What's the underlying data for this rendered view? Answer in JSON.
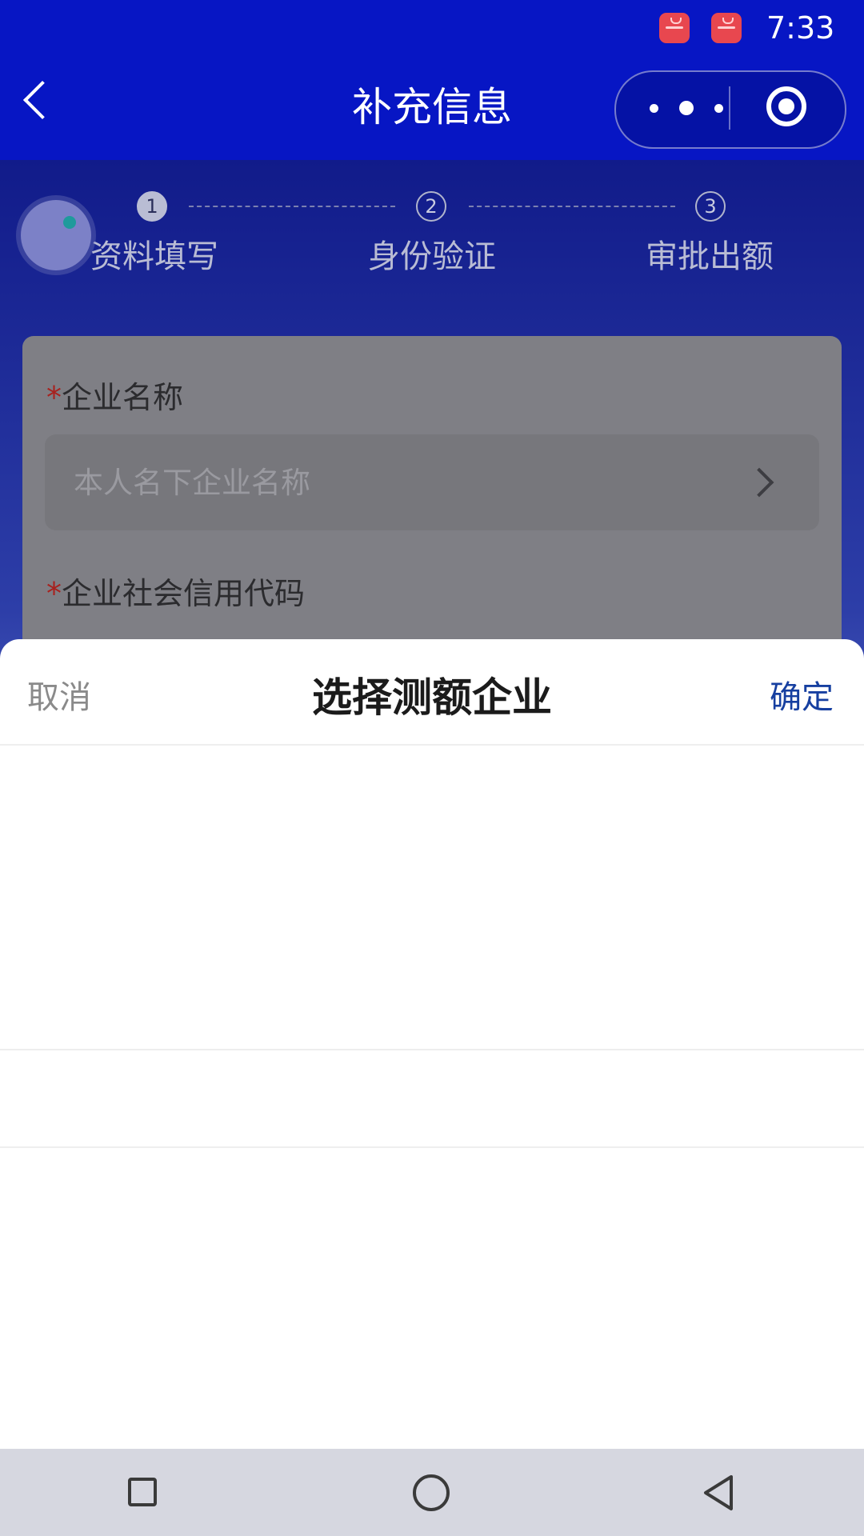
{
  "status_bar": {
    "time": "7:33",
    "icons": [
      "app-store-icon",
      "app-store-icon"
    ]
  },
  "nav_bar": {
    "title": "补充信息",
    "back_icon": "chevron-left-icon",
    "more_icon": "more-dots-icon",
    "close_icon": "target-circle-icon"
  },
  "steps": [
    {
      "number": "1",
      "label": "资料填写",
      "state": "active"
    },
    {
      "number": "2",
      "label": "身份验证",
      "state": "todo"
    },
    {
      "number": "3",
      "label": "审批出额",
      "state": "todo"
    }
  ],
  "form": {
    "required_mark": "*",
    "company_name": {
      "label": "企业名称",
      "placeholder": "本人名下企业名称"
    },
    "credit_code": {
      "label": "企业社会信用代码"
    }
  },
  "picker_sheet": {
    "cancel_label": "取消",
    "title": "选择测额企业",
    "confirm_label": "确定"
  },
  "colors": {
    "header_blue": "#0716c4",
    "confirm_blue": "#163fa0",
    "required_red": "#a8211e"
  }
}
